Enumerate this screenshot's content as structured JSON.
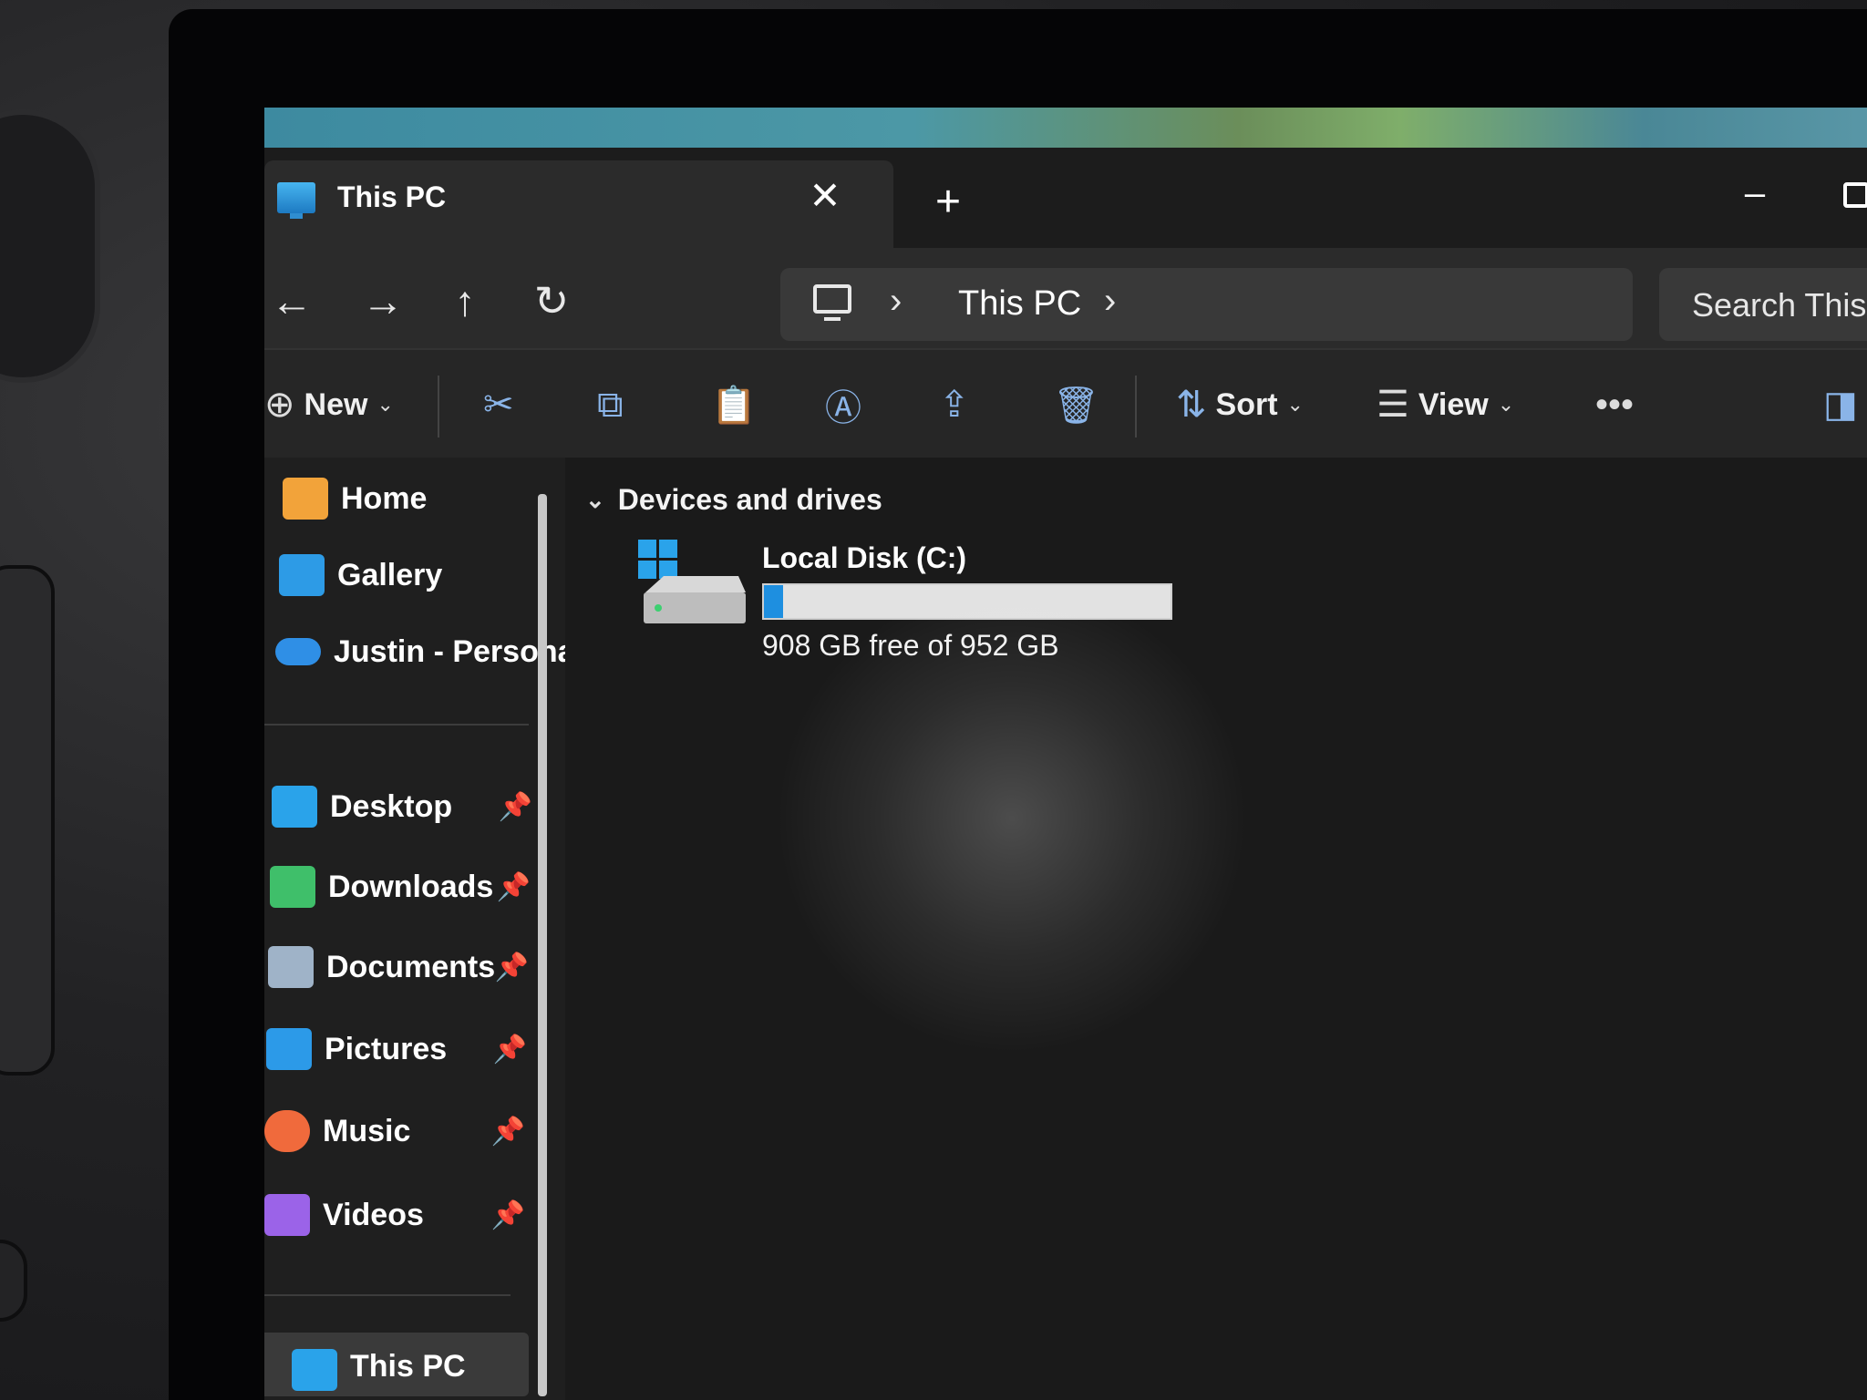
{
  "window": {
    "tab_title": "This PC",
    "tab_close_glyph": "✕",
    "new_tab_glyph": "+",
    "minimize_glyph": "–"
  },
  "nav": {
    "back_glyph": "←",
    "forward_glyph": "→",
    "up_glyph": "↑",
    "refresh_glyph": "↻",
    "breadcrumb": [
      "This PC"
    ],
    "chevron_glyph": "›",
    "search_placeholder": "Search This"
  },
  "toolbar": {
    "new_label": "New",
    "sort_label": "Sort",
    "view_label": "View",
    "more_glyph": "•••",
    "caret_glyph": "⌄",
    "icons": [
      "cut-icon",
      "copy-icon",
      "paste-icon",
      "rename-icon",
      "share-icon",
      "delete-icon"
    ]
  },
  "sidebar": {
    "top_items": [
      {
        "label": "Home",
        "icon": "home-icon",
        "color": "#f2a33a"
      },
      {
        "label": "Gallery",
        "icon": "gallery-icon",
        "color": "#2d9be6"
      },
      {
        "label": "Justin - Personal",
        "icon": "onedrive-icon",
        "color": "#2f8fe6"
      }
    ],
    "pinned_items": [
      {
        "label": "Desktop",
        "icon": "desktop-icon",
        "color": "#2aa3ea"
      },
      {
        "label": "Downloads",
        "icon": "downloads-icon",
        "color": "#3fbf6a"
      },
      {
        "label": "Documents",
        "icon": "documents-icon",
        "color": "#9fb3c8"
      },
      {
        "label": "Pictures",
        "icon": "pictures-icon",
        "color": "#2c9ae8"
      },
      {
        "label": "Music",
        "icon": "music-icon",
        "color": "#f06a3c"
      },
      {
        "label": "Videos",
        "icon": "videos-icon",
        "color": "#9b63e8"
      }
    ],
    "pin_glyph": "📌",
    "expand_glyph": "›",
    "bottom_item": {
      "label": "This PC"
    }
  },
  "main": {
    "group_header": "Devices and drives",
    "group_chevron": "⌄",
    "drives": [
      {
        "name": "Local Disk (C:)",
        "free_text": "908 GB free of 952 GB",
        "used_fraction": 0.046,
        "bar_color": "#1e8fe0"
      }
    ]
  }
}
